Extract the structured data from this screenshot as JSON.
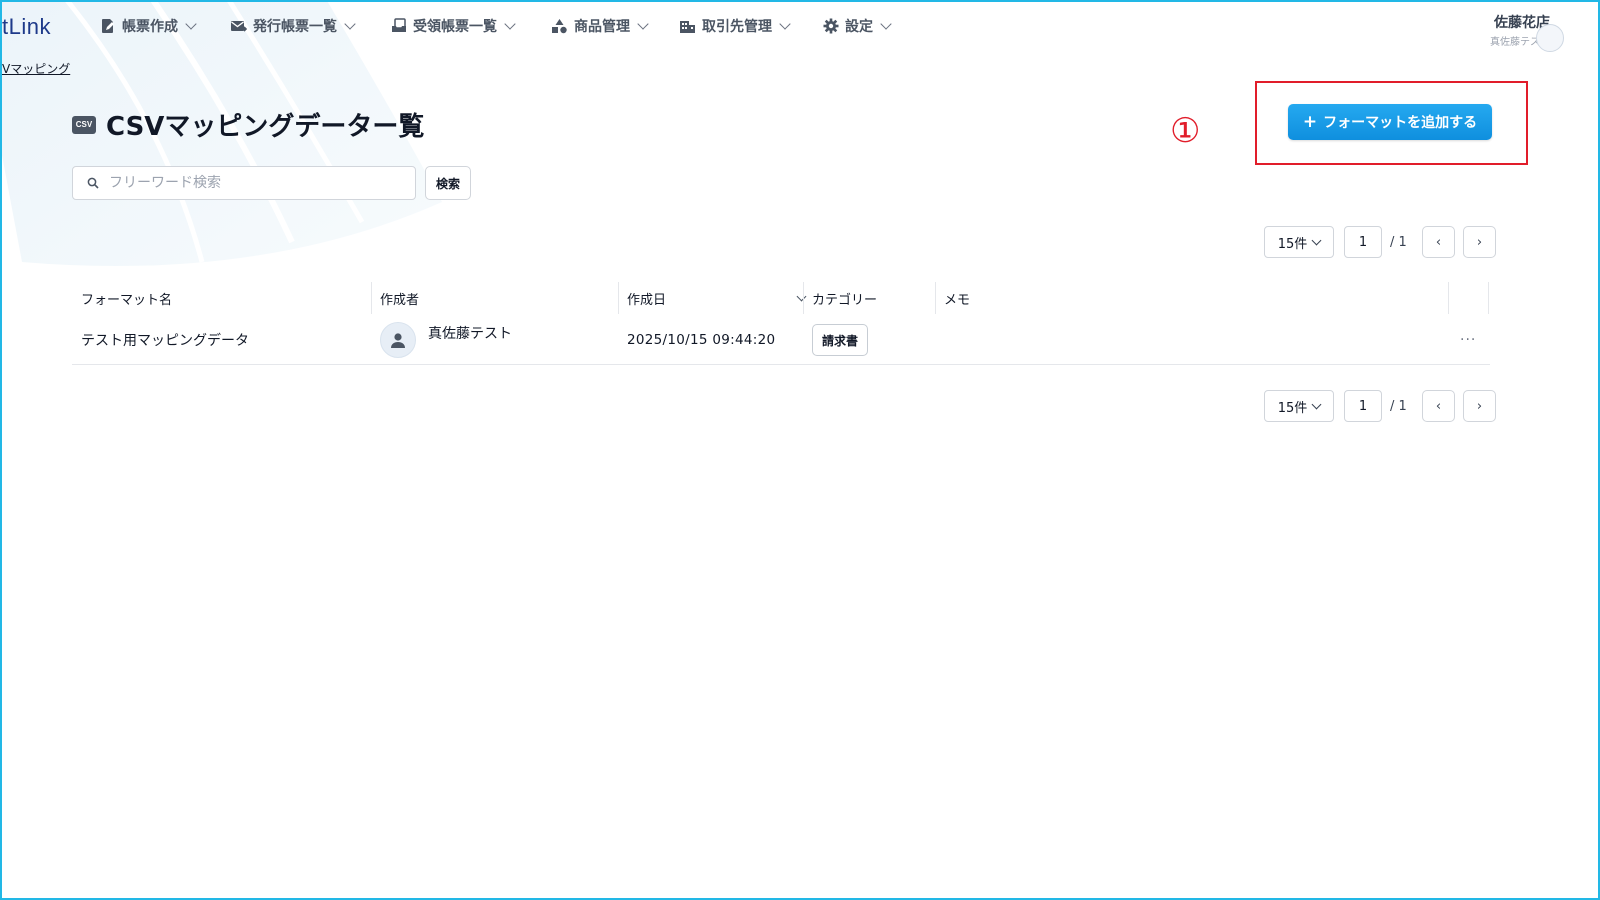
{
  "app": {
    "logo_text": "tLink"
  },
  "nav": {
    "items": [
      {
        "label": "帳票作成",
        "icon": "document-edit-icon"
      },
      {
        "label": "発行帳票一覧",
        "icon": "mail-send-icon"
      },
      {
        "label": "受領帳票一覧",
        "icon": "inbox-receive-icon"
      },
      {
        "label": "商品管理",
        "icon": "shapes-icon"
      },
      {
        "label": "取引先管理",
        "icon": "building-icon"
      },
      {
        "label": "設定",
        "icon": "gear-icon"
      }
    ]
  },
  "user": {
    "company": "佐藤花店",
    "name": "真佐藤テスト"
  },
  "breadcrumb": {
    "current": "Vマッピング"
  },
  "page": {
    "icon_text": "CSV",
    "title": "CSVマッピングデーター覧",
    "add_button_label": "フォーマットを追加する",
    "add_button_plus": "+"
  },
  "annotation": {
    "marker": "①",
    "color": "#e11d2a"
  },
  "search": {
    "placeholder": "フリーワード検索",
    "value": "",
    "button_label": "検索"
  },
  "pagination": {
    "page_size": "15件",
    "current_page": "1",
    "total": "/ 1",
    "prev": "‹",
    "next": "›"
  },
  "table": {
    "headers": {
      "name": "フォーマット名",
      "creator": "作成者",
      "created": "作成日",
      "category": "カテゴリー",
      "memo": "メモ"
    },
    "rows": [
      {
        "name": "テスト用マッピングデータ",
        "creator": "真佐藤テスト",
        "created": "2025/10/15 09:44:20",
        "category": "請求書",
        "memo": "",
        "actions": "···"
      }
    ]
  },
  "colors": {
    "accent": "#1a9be8",
    "frame": "#22b8e6",
    "highlight": "#e11d2a"
  }
}
